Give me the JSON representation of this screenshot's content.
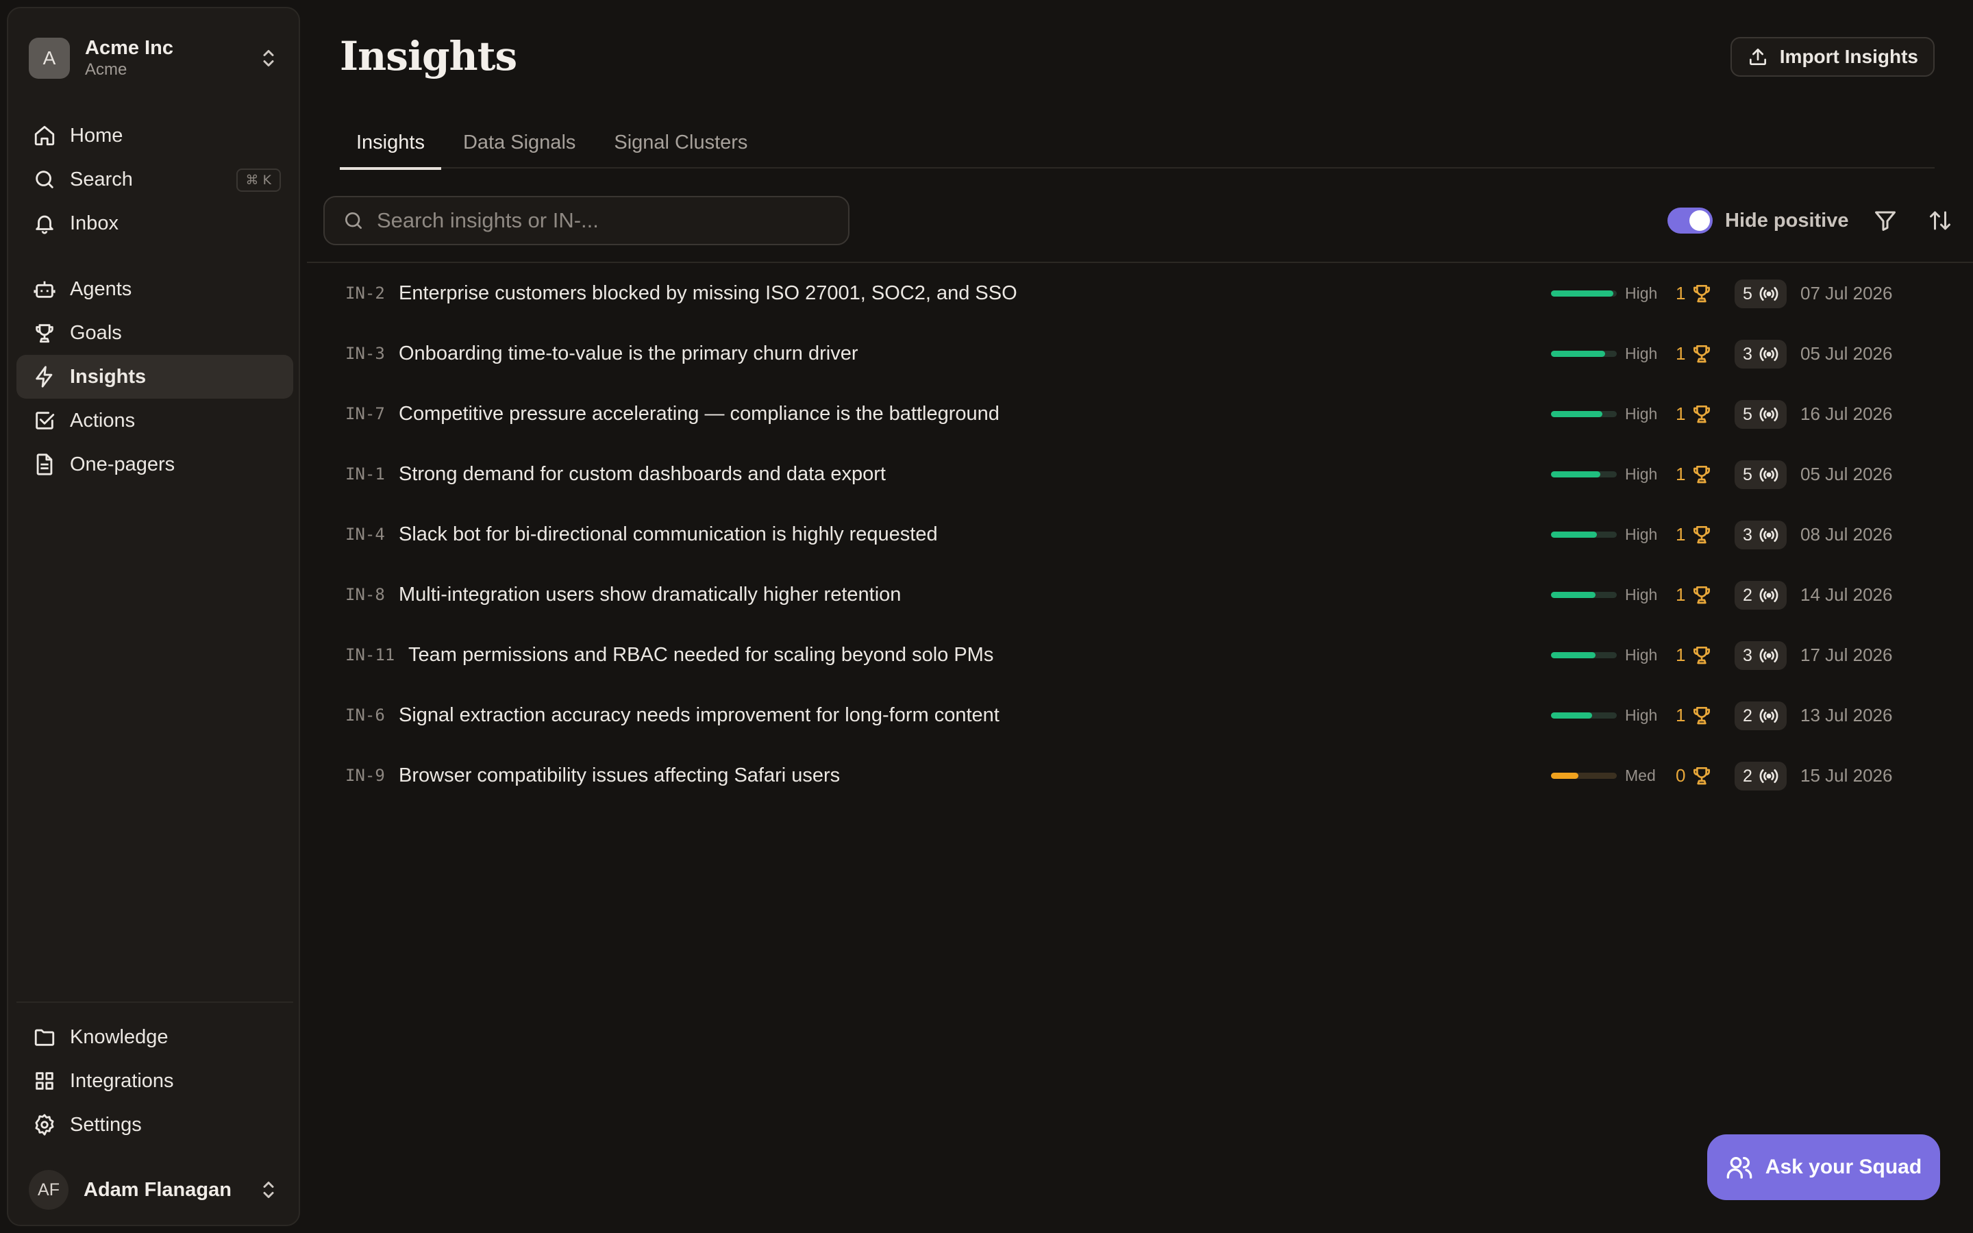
{
  "org": {
    "initial": "A",
    "name": "Acme Inc",
    "subtitle": "Acme"
  },
  "nav": {
    "primary": [
      {
        "label": "Home",
        "icon": "home-icon"
      },
      {
        "label": "Search",
        "icon": "search-icon",
        "shortcut": "⌘ K"
      },
      {
        "label": "Inbox",
        "icon": "bell-icon"
      }
    ],
    "secondary": [
      {
        "label": "Agents",
        "icon": "bot-icon"
      },
      {
        "label": "Goals",
        "icon": "trophy-icon"
      },
      {
        "label": "Insights",
        "icon": "lightning-icon",
        "active": true
      },
      {
        "label": "Actions",
        "icon": "checkbox-icon"
      },
      {
        "label": "One-pagers",
        "icon": "document-icon"
      }
    ],
    "bottom": [
      {
        "label": "Knowledge",
        "icon": "folder-icon"
      },
      {
        "label": "Integrations",
        "icon": "grid-icon"
      },
      {
        "label": "Settings",
        "icon": "gear-icon"
      }
    ]
  },
  "user": {
    "initials": "AF",
    "name": "Adam Flanagan"
  },
  "page": {
    "title": "Insights",
    "import_label": "Import Insights",
    "tabs": [
      "Insights",
      "Data Signals",
      "Signal Clusters"
    ],
    "search_placeholder": "Search insights or IN-...",
    "toggle_label": "Hide positive",
    "toggle_on": true
  },
  "insights": [
    {
      "id": "IN-2",
      "title": "Enterprise customers blocked by missing ISO 27001, SOC2, and SSO",
      "level": "High",
      "score": 0.95,
      "goals": "1",
      "signals": "5",
      "date": "07 Jul 2026"
    },
    {
      "id": "IN-3",
      "title": "Onboarding time-to-value is the primary churn driver",
      "level": "High",
      "score": 0.82,
      "goals": "1",
      "signals": "3",
      "date": "05 Jul 2026"
    },
    {
      "id": "IN-7",
      "title": "Competitive pressure accelerating — compliance is the battleground",
      "level": "High",
      "score": 0.78,
      "goals": "1",
      "signals": "5",
      "date": "16 Jul 2026"
    },
    {
      "id": "IN-1",
      "title": "Strong demand for custom dashboards and data export",
      "level": "High",
      "score": 0.75,
      "goals": "1",
      "signals": "5",
      "date": "05 Jul 2026"
    },
    {
      "id": "IN-4",
      "title": "Slack bot for bi-directional communication is highly requested",
      "level": "High",
      "score": 0.7,
      "goals": "1",
      "signals": "3",
      "date": "08 Jul 2026"
    },
    {
      "id": "IN-8",
      "title": "Multi-integration users show dramatically higher retention",
      "level": "High",
      "score": 0.68,
      "goals": "1",
      "signals": "2",
      "date": "14 Jul 2026"
    },
    {
      "id": "IN-11",
      "title": "Team permissions and RBAC needed for scaling beyond solo PMs",
      "level": "High",
      "score": 0.68,
      "goals": "1",
      "signals": "3",
      "date": "17 Jul 2026"
    },
    {
      "id": "IN-6",
      "title": "Signal extraction accuracy needs improvement for long-form content",
      "level": "High",
      "score": 0.62,
      "goals": "1",
      "signals": "2",
      "date": "13 Jul 2026"
    },
    {
      "id": "IN-9",
      "title": "Browser compatibility issues affecting Safari users",
      "level": "Med",
      "score": 0.42,
      "goals": "0",
      "signals": "2",
      "date": "15 Jul 2026"
    }
  ],
  "squad_button": "Ask your Squad",
  "colors": {
    "accent": "#7a6ee0",
    "high": "#20bf7f",
    "med": "#f0a21e",
    "goal": "#e9a83a"
  }
}
